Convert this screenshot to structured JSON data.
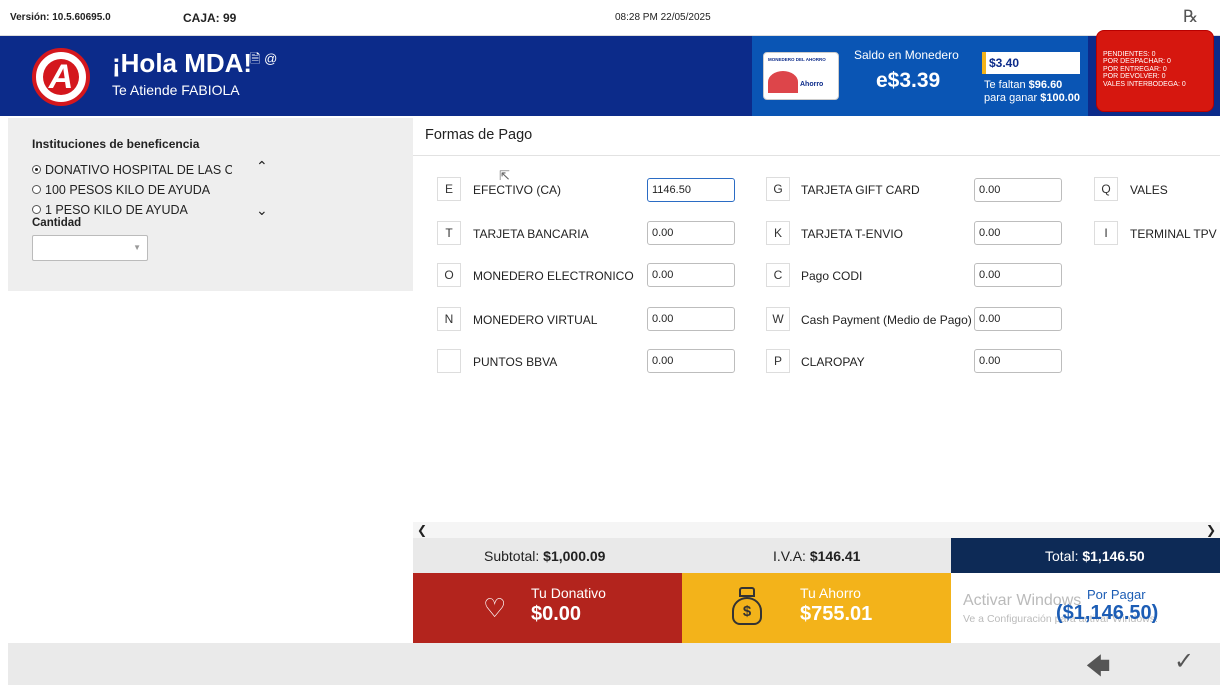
{
  "topbar": {
    "version": "Versión: 10.5.60695.0",
    "caja": "CAJA: 99",
    "datetime": "08:28 PM 22/05/2025",
    "rx": "℞"
  },
  "header": {
    "greeting": "¡Hola MDA!",
    "greeting_icons": "🗎 @",
    "attends": "Te Atiende FABIOLA",
    "card_caption": "MONEDERO DEL AHORRO",
    "card_brand": "Ahorro",
    "saldo_label": "Saldo en Monedero",
    "saldo_value": "e$3.39",
    "puntos_value": "$3.40",
    "faltan_prefix": "Te faltan",
    "faltan_amount": "$96.60",
    "ganar_prefix": "para ganar",
    "ganar_amount": "$100.00",
    "status": [
      "PENDIENTES: 0",
      "POR DESPACHAR: 0",
      "POR ENTREGAR: 0",
      "POR DEVOLVER: 0",
      "VALES INTERBODEGA: 0"
    ]
  },
  "left": {
    "title": "Instituciones de beneficencia",
    "options": [
      {
        "label": "DONATIVO HOSPITAL DE LAS CALIFORNIAS",
        "selected": true
      },
      {
        "label": "100 PESOS KILO DE AYUDA",
        "selected": false
      },
      {
        "label": "1 PESO KILO DE AYUDA",
        "selected": false
      }
    ],
    "cantidad_label": "Cantidad",
    "cantidad_value": ""
  },
  "payments": {
    "title": "Formas de Pago",
    "col1": [
      {
        "key": "E",
        "label": "EFECTIVO (CA)",
        "value": "1146.50"
      },
      {
        "key": "T",
        "label": "TARJETA BANCARIA",
        "value": "0.00"
      },
      {
        "key": "O",
        "label": "MONEDERO ELECTRONICO",
        "value": "0.00"
      },
      {
        "key": "N",
        "label": "MONEDERO VIRTUAL",
        "value": "0.00"
      },
      {
        "key": "",
        "label": "PUNTOS BBVA",
        "value": "0.00"
      }
    ],
    "col2": [
      {
        "key": "G",
        "label": "TARJETA GIFT CARD",
        "value": "0.00"
      },
      {
        "key": "K",
        "label": "TARJETA T-ENVIO",
        "value": "0.00"
      },
      {
        "key": "C",
        "label": "Pago CODI",
        "value": "0.00"
      },
      {
        "key": "W",
        "label": "Cash Payment (Medio de Pago)",
        "value": "0.00"
      },
      {
        "key": "P",
        "label": "CLAROPAY",
        "value": "0.00"
      }
    ],
    "col3": [
      {
        "key": "Q",
        "label": "VALES"
      },
      {
        "key": "I",
        "label": "TERMINAL TPV"
      }
    ]
  },
  "totals": {
    "subtotal_label": "Subtotal:",
    "subtotal_value": "$1,000.09",
    "iva_label": "I.V.A:",
    "iva_value": "$146.41",
    "total_label": "Total:",
    "total_value": "$1,146.50"
  },
  "cards": {
    "donativo_label": "Tu Donativo",
    "donativo_value": "$0.00",
    "ahorro_label": "Tu Ahorro",
    "ahorro_value": "$755.01",
    "porpagar_label": "Por Pagar",
    "porpagar_value": "($1,146.50)",
    "watermark_title": "Activar Windows",
    "watermark_sub": "Ve a Configuración para activar Windows."
  },
  "colors": {
    "header_blue": "#0c2b8a",
    "monedero_blue": "#0a55b4",
    "brand_red": "#d4171d",
    "donativo_red": "#b3241d",
    "ahorro_yellow": "#f3b31a",
    "total_navy": "#0d2a56"
  },
  "icons": {
    "back": "arrow-left-icon",
    "confirm": "checkmark-icon",
    "heart": "heart-icon",
    "bag": "money-bag-icon"
  }
}
